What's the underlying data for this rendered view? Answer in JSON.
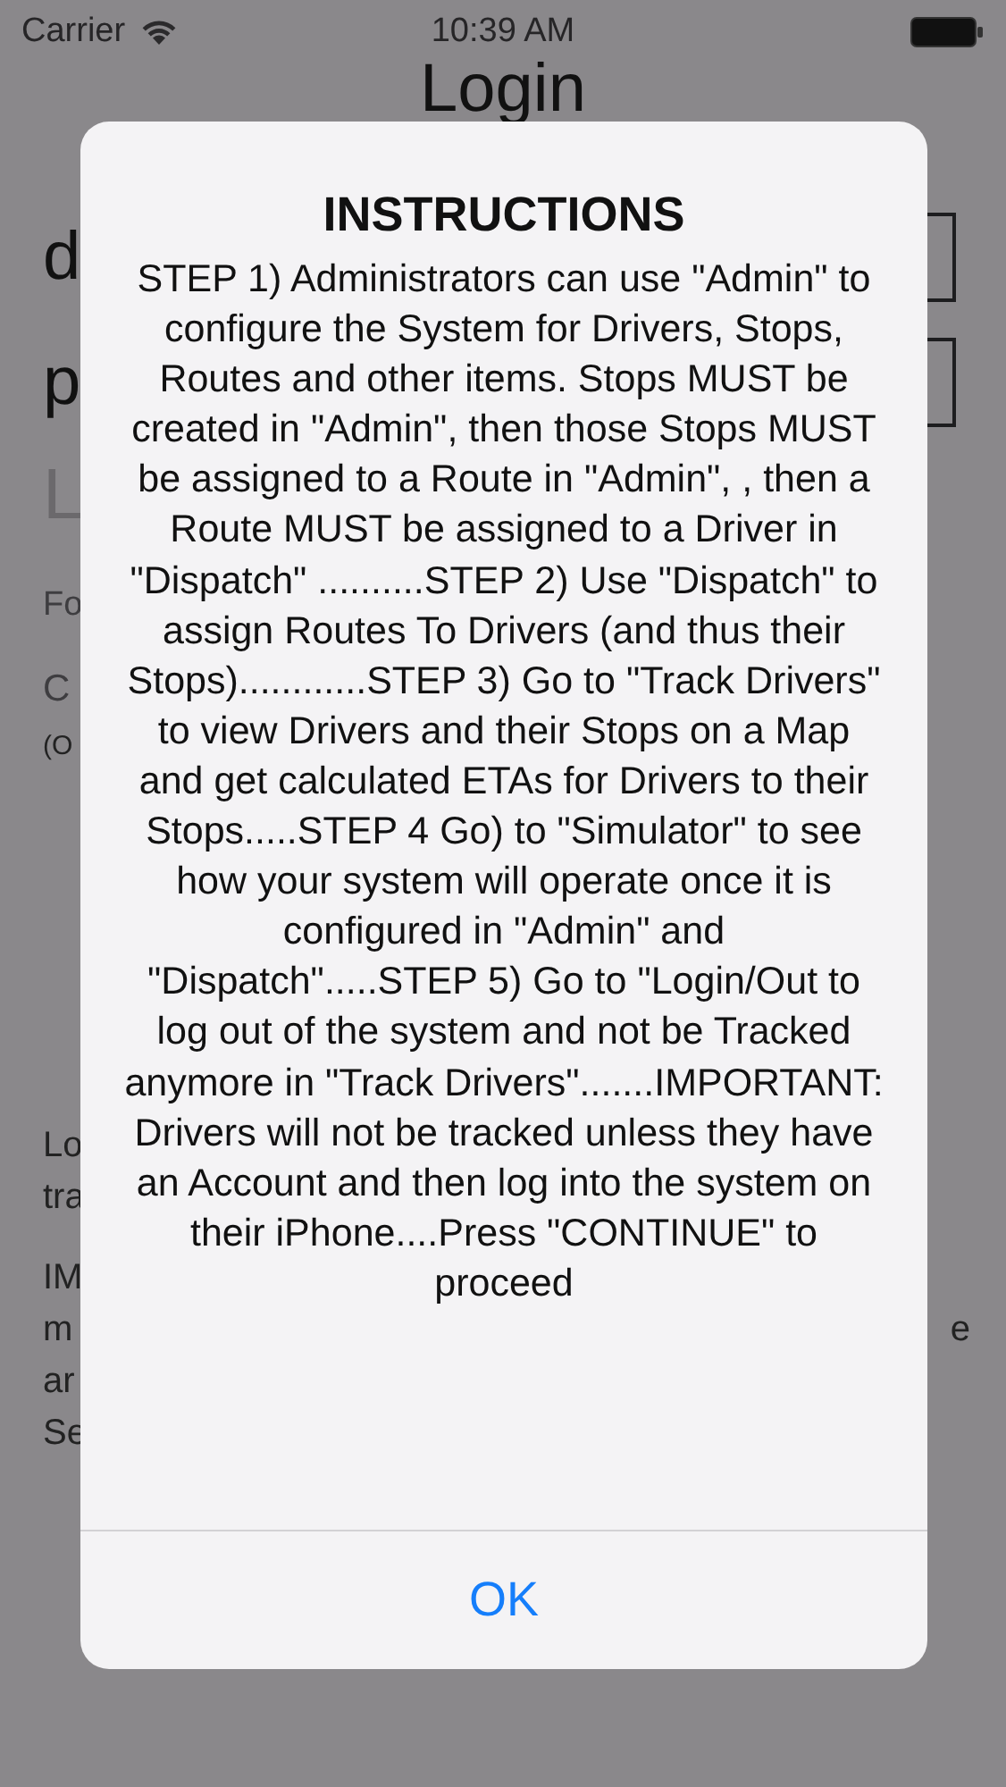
{
  "status_bar": {
    "carrier": "Carrier",
    "time": "10:39 AM"
  },
  "background": {
    "title": "Login",
    "top_rows": [
      {
        "kind": "field",
        "text": "d"
      },
      {
        "kind": "field",
        "text": "p"
      },
      {
        "kind": "big",
        "text": "L"
      },
      {
        "kind": "caption",
        "text": "Fo"
      },
      {
        "kind": "subtitle",
        "text": "C"
      },
      {
        "kind": "note",
        "text": "(O"
      }
    ],
    "bottom_rows": [
      {
        "kind": "text",
        "text": "Lo"
      },
      {
        "kind": "text",
        "text": "tra"
      },
      {
        "kind": "text_gap",
        "text": "IM"
      },
      {
        "kind": "text",
        "text": "m",
        "right": "e"
      },
      {
        "kind": "text",
        "text": "ar"
      },
      {
        "kind": "text",
        "text": "Se"
      }
    ]
  },
  "alert": {
    "title": "INSTRUCTIONS",
    "message": "STEP 1) Administrators can use \"Admin\" to configure the System for Drivers, Stops, Routes and other items. Stops MUST be created in \"Admin\", then those Stops MUST be assigned to a Route in \"Admin\", , then a Route MUST be assigned to a Driver in \"Dispatch\" ..........STEP 2) Use \"Dispatch\" to assign Routes To Drivers (and thus their Stops)............STEP 3) Go to \"Track Drivers\" to view Drivers and their Stops on a Map and get calculated ETAs for Drivers to their Stops.....STEP 4 Go) to \"Simulator\" to see how your system will operate once it is configured in \"Admin\" and \"Dispatch\".....STEP 5) Go to \"Login/Out to log out of the system and not be Tracked anymore in \"Track Drivers\".......IMPORTANT: Drivers will not be tracked unless they have an Account and then log into the system on their iPhone....Press \"CONTINUE\" to proceed",
    "button": "OK"
  }
}
